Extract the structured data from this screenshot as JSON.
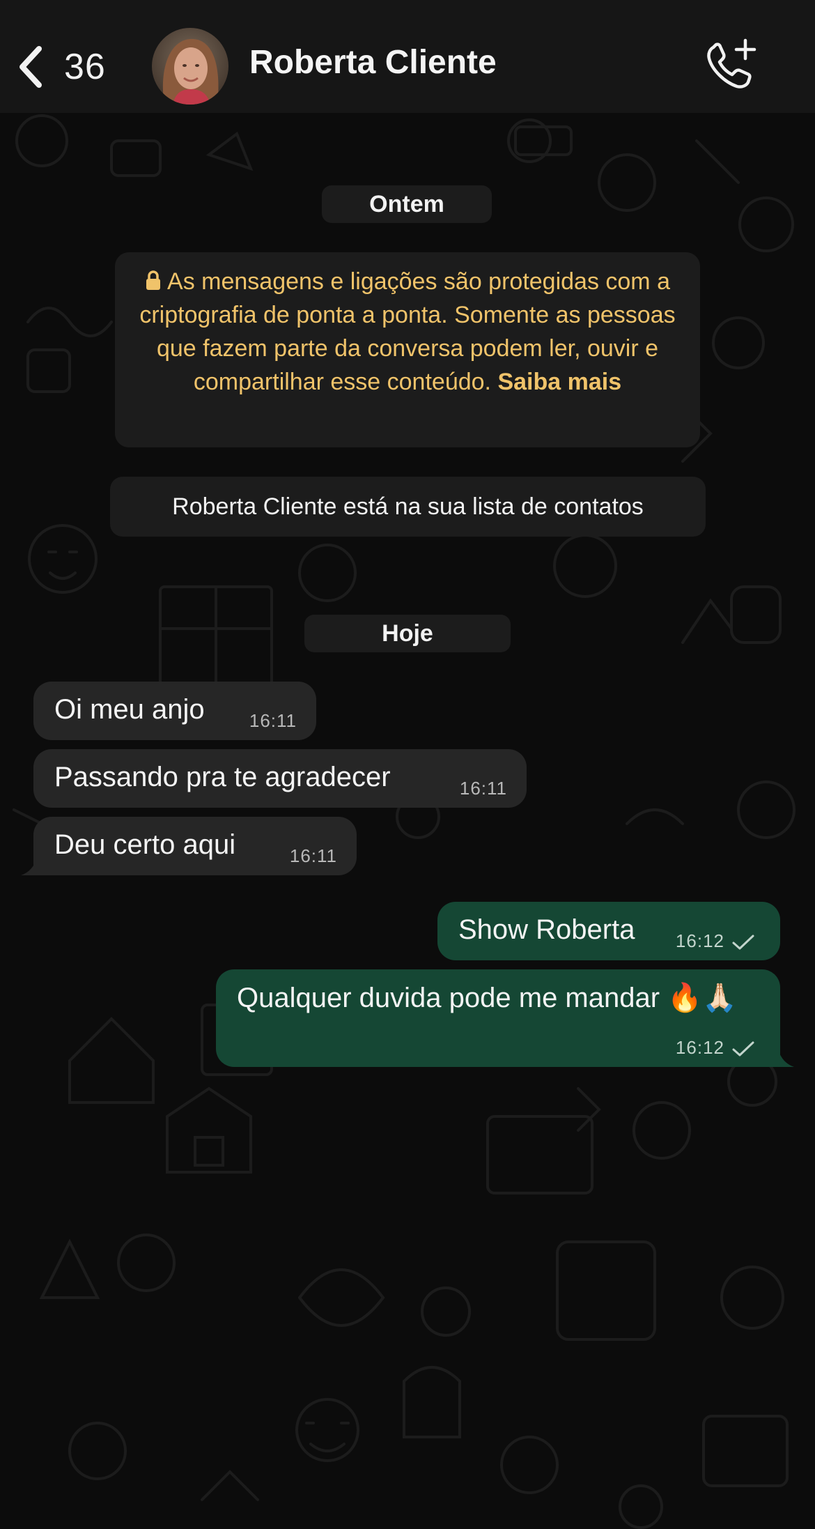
{
  "header": {
    "back_count": "36",
    "contact_name": "Roberta Cliente"
  },
  "chat": {
    "date_ontem": "Ontem",
    "encryption_notice": {
      "text": "As mensagens e ligações são protegidas com a criptografia de ponta a ponta. Somente as pessoas que fazem parte da conversa podem ler, ouvir e compartilhar esse conteúdo.",
      "link": "Saiba mais"
    },
    "contact_note": "Roberta Cliente está na sua lista de contatos",
    "date_hoje": "Hoje",
    "messages": [
      {
        "direction": "incoming",
        "text": "Oi meu anjo",
        "time": "16:11"
      },
      {
        "direction": "incoming",
        "text": "Passando pra te agradecer",
        "time": "16:11"
      },
      {
        "direction": "incoming",
        "text": "Deu certo aqui",
        "time": "16:11"
      },
      {
        "direction": "outgoing",
        "text": "Show Roberta",
        "time": "16:12",
        "status": "sent"
      },
      {
        "direction": "outgoing",
        "text": "Qualquer duvida pode me mandar 🔥🙏🏻",
        "time": "16:12",
        "status": "sent"
      }
    ]
  },
  "colors": {
    "header_bg": "#161616",
    "incoming_bubble": "#262626",
    "outgoing_bubble": "#154734",
    "notice_text": "#f0c36a"
  }
}
